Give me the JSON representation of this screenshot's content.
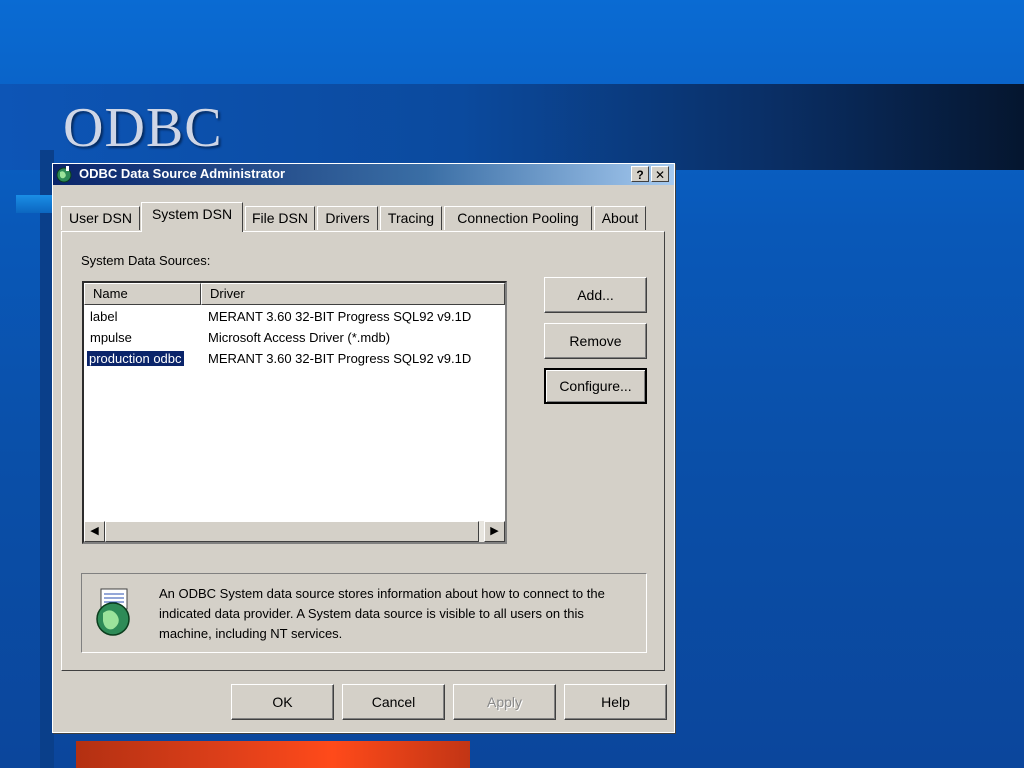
{
  "slide": {
    "title": "ODBC"
  },
  "window": {
    "title": "ODBC Data Source Administrator",
    "help_button": "?",
    "close_button": "✕"
  },
  "tabs": [
    {
      "label": "User DSN"
    },
    {
      "label": "System DSN",
      "active": true
    },
    {
      "label": "File DSN"
    },
    {
      "label": "Drivers"
    },
    {
      "label": "Tracing"
    },
    {
      "label": "Connection Pooling"
    },
    {
      "label": "About"
    }
  ],
  "panel": {
    "section_label": "System Data Sources:",
    "columns": [
      "Name",
      "Driver"
    ],
    "rows": [
      {
        "name": "label",
        "driver": "MERANT 3.60 32-BIT Progress SQL92 v9.1D"
      },
      {
        "name": "mpulse",
        "driver": "Microsoft Access Driver (*.mdb)"
      },
      {
        "name": "production odbc",
        "driver": "MERANT 3.60 32-BIT Progress SQL92 v9.1D",
        "selected": true
      }
    ],
    "buttons": {
      "add": "Add...",
      "remove": "Remove",
      "configure": "Configure..."
    },
    "info_text": "An ODBC System data source stores information about how to connect to the indicated data provider.   A System data source is visible to all users on this machine, including NT services."
  },
  "footer_buttons": {
    "ok": "OK",
    "cancel": "Cancel",
    "apply": "Apply",
    "help": "Help"
  },
  "colors": {
    "selection": "#0a246a",
    "titlebar_start": "#0a246a",
    "accent_bar": "#ff4a1a"
  }
}
